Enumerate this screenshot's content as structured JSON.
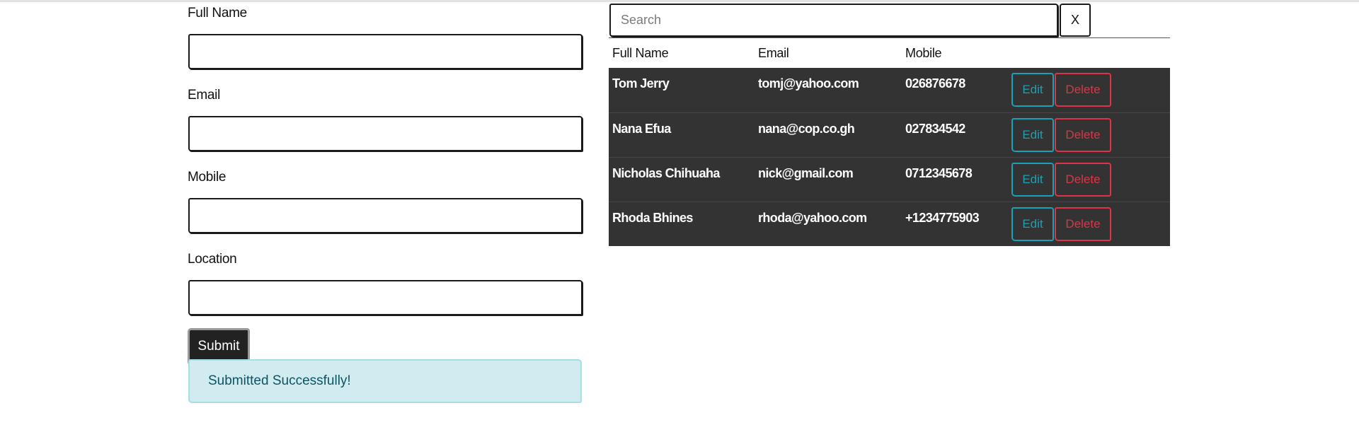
{
  "form": {
    "fields": [
      {
        "label": "Full Name",
        "value": ""
      },
      {
        "label": "Email",
        "value": ""
      },
      {
        "label": "Mobile",
        "value": ""
      },
      {
        "label": "Location",
        "value": ""
      }
    ],
    "submit_label": "Submit",
    "alert": "Submitted Successfully!"
  },
  "search": {
    "placeholder": "Search",
    "clear_label": "X"
  },
  "table": {
    "headers": [
      "Full Name",
      "Email",
      "Mobile",
      ""
    ],
    "rows": [
      {
        "name": "Tom Jerry",
        "email": "tomj@yahoo.com",
        "mobile": "026876678",
        "edit": "Edit",
        "delete": "Delete"
      },
      {
        "name": "Nana Efua",
        "email": "nana@cop.co.gh",
        "mobile": "027834542",
        "edit": "Edit",
        "delete": "Delete"
      },
      {
        "name": "Nicholas Chihuaha",
        "email": "nick@gmail.com",
        "mobile": "0712345678",
        "edit": "Edit",
        "delete": "Delete"
      },
      {
        "name": "Rhoda Bhines",
        "email": "rhoda@yahoo.com",
        "mobile": "+1234775903",
        "edit": "Edit",
        "delete": "Delete"
      }
    ]
  },
  "colors": {
    "row_bg": "#333333",
    "edit": "#17a2b8",
    "delete": "#dc3545",
    "alert_bg": "#d1ecf1",
    "alert_text": "#0c5460",
    "submit_bg": "#222222"
  }
}
